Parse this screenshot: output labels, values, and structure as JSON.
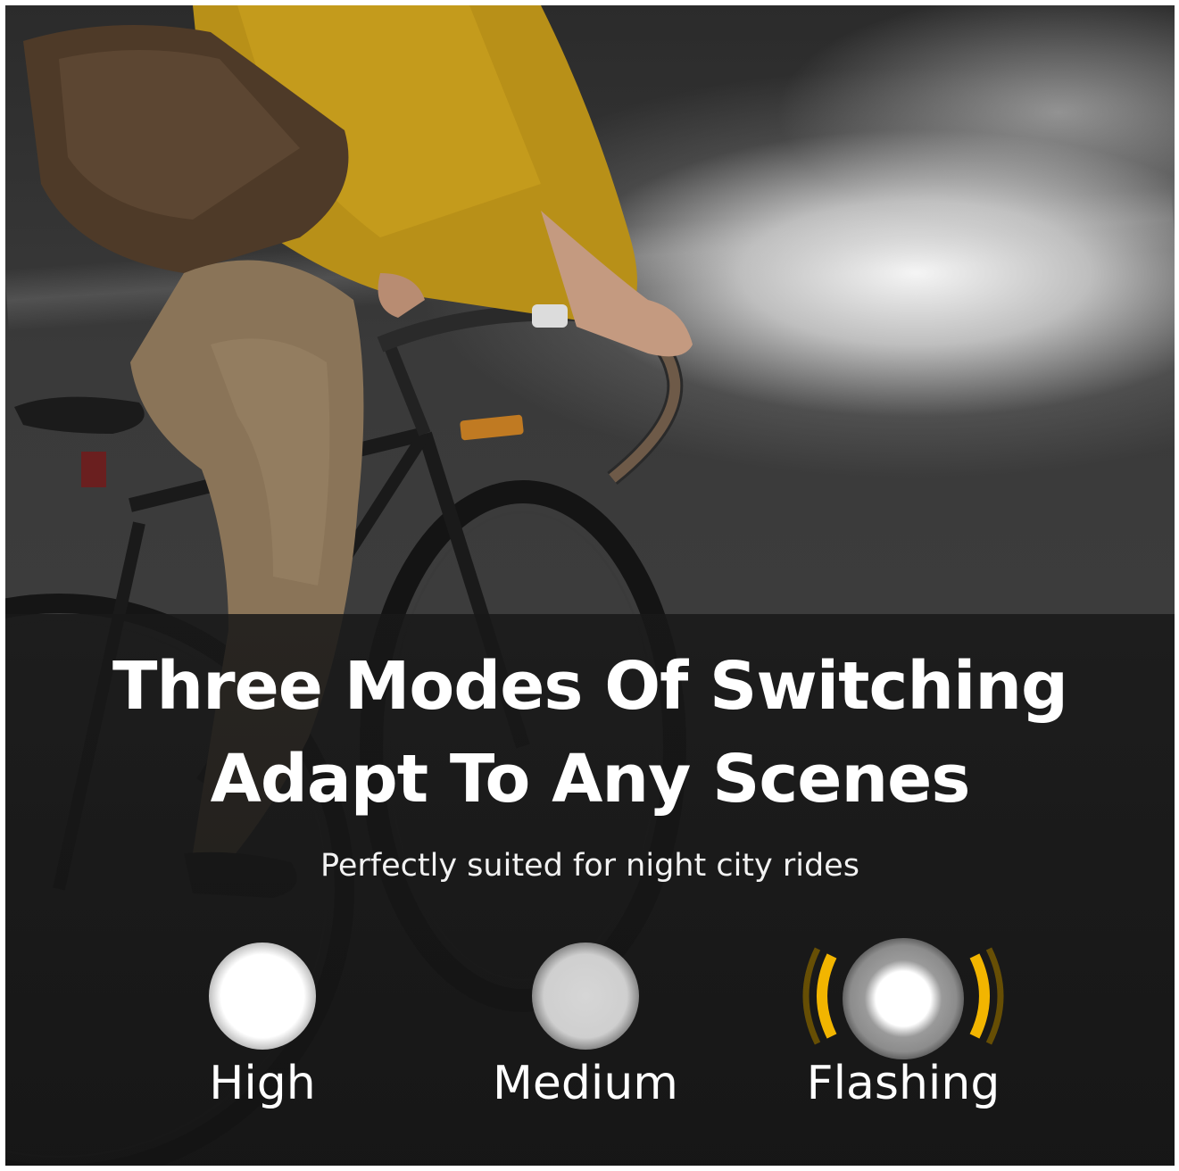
{
  "headline": {
    "line1": "Three Modes Of Switching",
    "line2": "Adapt To Any Scenes"
  },
  "subtitle": "Perfectly suited for night city rides",
  "modes": [
    {
      "label": "High",
      "icon": "bright-light-icon"
    },
    {
      "label": "Medium",
      "icon": "dim-light-icon"
    },
    {
      "label": "Flashing",
      "icon": "flashing-light-icon"
    }
  ],
  "colors": {
    "text": "#ffffff",
    "flash_accent": "#f2b500",
    "panel": "#181818"
  }
}
